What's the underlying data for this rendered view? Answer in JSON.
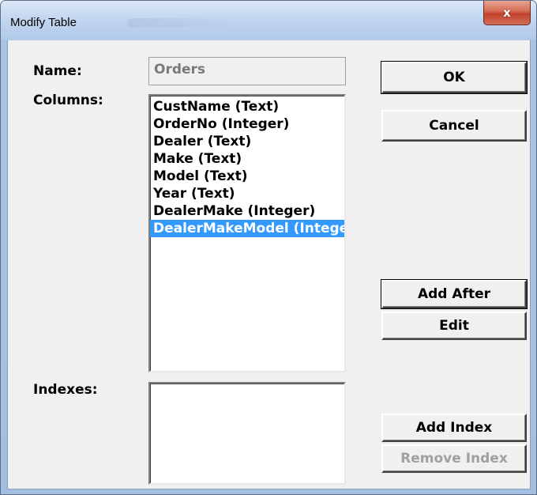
{
  "window": {
    "title": "Modify Table",
    "close_glyph": "x"
  },
  "form": {
    "name_label": "Name:",
    "name_value": "Orders",
    "columns_label": "Columns:",
    "indexes_label": "Indexes:"
  },
  "columns": {
    "items": [
      "CustName (Text)",
      "OrderNo (Integer)",
      "Dealer (Text)",
      "Make (Text)",
      "Model (Text)",
      "Year (Text)",
      "DealerMake (Integer)",
      "DealerMakeModel (Integer)"
    ],
    "selected_index": 7
  },
  "indexes": {
    "items": []
  },
  "buttons": {
    "ok": "OK",
    "cancel": "Cancel",
    "add_after": "Add After",
    "edit": "Edit",
    "add_index": "Add Index",
    "remove_index": "Remove Index"
  }
}
